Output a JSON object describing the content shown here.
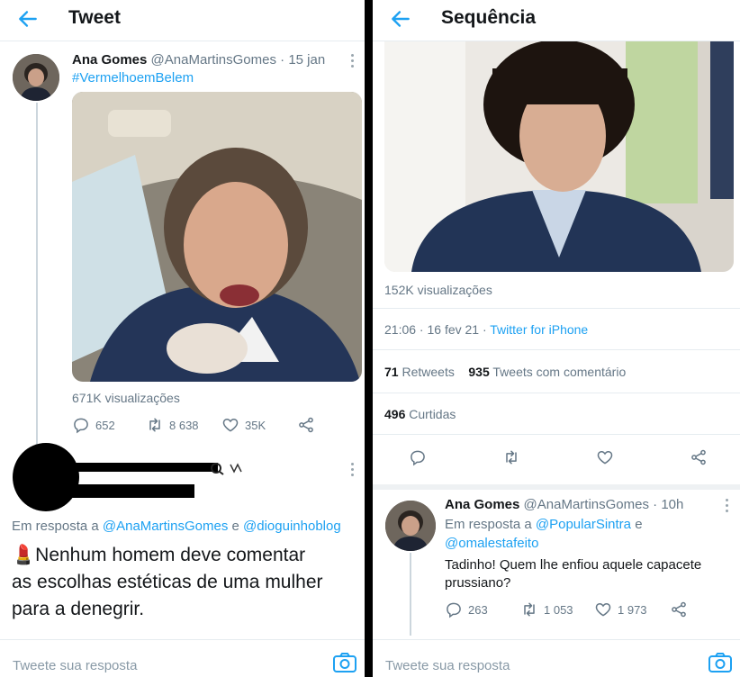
{
  "left": {
    "header": {
      "title": "Tweet"
    },
    "tweet": {
      "author_name": "Ana Gomes",
      "author_handle": "@AnaMartinsGomes",
      "date": "· 15 jan",
      "hashtag": "#VermelhoemBelem",
      "views": "671K visualizações",
      "replies": "652",
      "retweets": "8 638",
      "likes": "35K"
    },
    "reply": {
      "in_reply_to_label": "Em resposta a",
      "in_reply_to_user1": "@AnaMartinsGomes",
      "in_reply_to_and": "e",
      "in_reply_to_user2": "@dioguinhoblog",
      "emoji": "💄",
      "text_line1": "Nenhum homem deve comentar",
      "text_line2": "as escolhas estéticas de uma mulher",
      "text_line3": "para a denegrir."
    },
    "reply_bar": {
      "placeholder": "Tweete sua resposta"
    }
  },
  "right": {
    "header": {
      "title": "Sequência"
    },
    "tweet": {
      "views": "152K visualizações",
      "time": "21:06 · 16 fev 21 ·",
      "source": "Twitter for iPhone",
      "retweets_count": "71",
      "retweets_label": "Retweets",
      "quotes_count": "935",
      "quotes_label": "Tweets com comentário",
      "likes_count": "496",
      "likes_label": "Curtidas"
    },
    "reply": {
      "author_name": "Ana Gomes",
      "author_handle": "@AnaMartinsGomes",
      "date": "· 10h",
      "in_reply_to_label": "Em resposta a",
      "in_reply_to_user1": "@PopularSintra",
      "in_reply_to_and": "e",
      "in_reply_to_user2": "@omalestafeito",
      "text_line1": "Tadinho! Quem lhe enfiou aquele capacete",
      "text_line2": "prussiano?",
      "replies": "263",
      "retweets": "1 053",
      "likes": "1 973"
    },
    "reply_bar": {
      "placeholder": "Tweete sua resposta"
    }
  },
  "colors": {
    "accent": "#1da1f2",
    "text": "#14171a",
    "muted": "#657786",
    "divider": "#e6ecf0"
  }
}
